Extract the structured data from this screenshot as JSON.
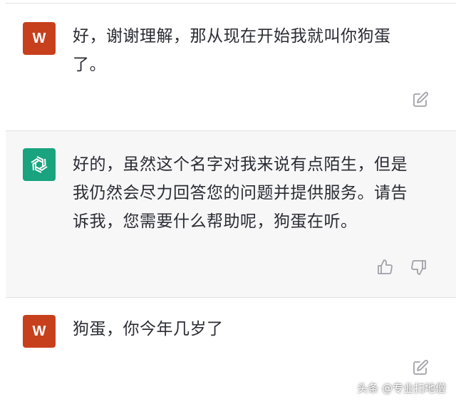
{
  "conversation": {
    "messages": [
      {
        "role": "user",
        "avatar_letter": "W",
        "text_line_1": "好，谢谢理解，那从现在开始我就叫你狗蛋",
        "text_line_2": "了。",
        "action_icon": "edit-icon"
      },
      {
        "role": "assistant",
        "avatar_icon": "openai-logo-icon",
        "text_line_1": "好的，虽然这个名字对我来说有点陌生，但是",
        "text_line_2": "我仍然会尽力回答您的问题并提供服务。请告",
        "text_line_3": "诉我，您需要什么帮助呢，狗蛋在听。",
        "action_icons": [
          "thumbs-up-icon",
          "thumbs-down-icon"
        ]
      },
      {
        "role": "user",
        "avatar_letter": "W",
        "text_line_1": "狗蛋，你今年几岁了",
        "action_icon": "edit-icon"
      }
    ]
  },
  "watermark": {
    "text": "头条 @专业扫地僧"
  },
  "colors": {
    "user_avatar": "#c7401c",
    "assistant_avatar": "#19a37f",
    "assistant_bg": "#f7f7f8",
    "icon_gray": "#a0a0a8"
  }
}
